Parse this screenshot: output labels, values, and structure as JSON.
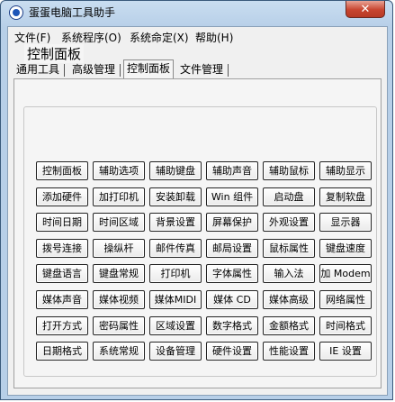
{
  "window": {
    "title": "蛋蛋电脑工具助手",
    "close_label": "✕"
  },
  "menubar": {
    "items": [
      "文件(F)",
      "系统程序(O)",
      "系统命定(X)",
      "帮助(H)"
    ]
  },
  "tabs": [
    "通用工具",
    "高级管理",
    "控制面板",
    "文件管理"
  ],
  "active_tab": "控制面板",
  "panel": {
    "group_title": "控制面板",
    "buttons": [
      [
        "控制面板",
        "辅助选项",
        "辅助键盘",
        "辅助声音",
        "辅助鼠标",
        "辅助显示"
      ],
      [
        "添加硬件",
        "加打印机",
        "安装卸载",
        "Win 组件",
        "启动盘",
        "复制软盘"
      ],
      [
        "时间日期",
        "时间区域",
        "背景设置",
        "屏幕保护",
        "外观设置",
        "显示器"
      ],
      [
        "拨号连接",
        "操纵杆",
        "邮件传真",
        "邮局设置",
        "鼠标属性",
        "键盘速度"
      ],
      [
        "键盘语言",
        "键盘常规",
        "打印机",
        "字体属性",
        "输入法",
        "加 Modem"
      ],
      [
        "媒体声音",
        "媒体视频",
        "媒体MIDI",
        "媒体 CD",
        "媒体高级",
        "网络属性"
      ],
      [
        "打开方式",
        "密码属性",
        "区域设置",
        "数字格式",
        "金额格式",
        "时间格式"
      ],
      [
        "日期格式",
        "系统常规",
        "设备管理",
        "硬件设置",
        "性能设置",
        "IE 设置"
      ]
    ]
  }
}
